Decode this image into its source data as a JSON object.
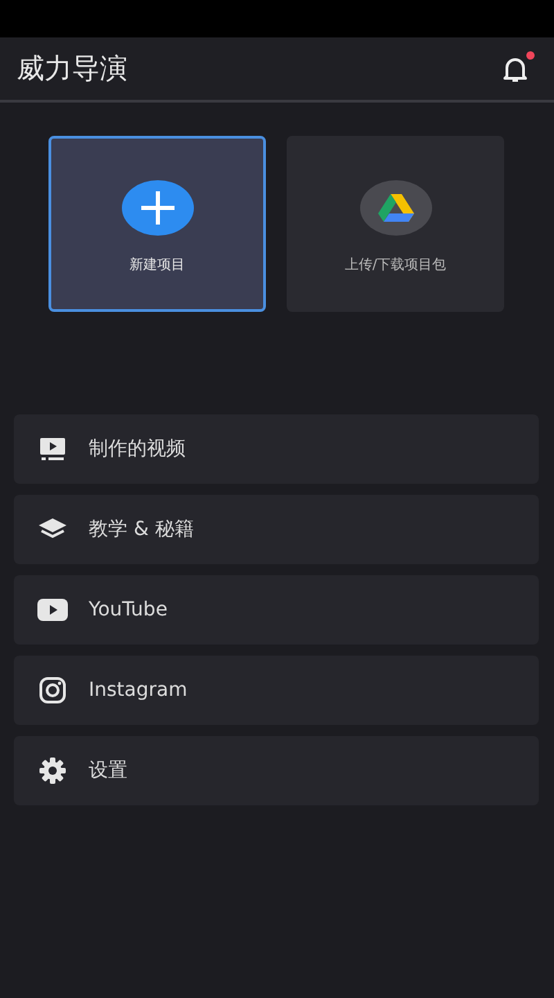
{
  "header": {
    "title": "威力导演",
    "notification_badge": true
  },
  "projects": [
    {
      "label": "新建项目",
      "selected": true
    },
    {
      "label": "上传/下载项目包",
      "selected": false
    }
  ],
  "menu": [
    {
      "label": "制作的视频"
    },
    {
      "label": "教学 & 秘籍"
    },
    {
      "label": "YouTube"
    },
    {
      "label": "Instagram"
    },
    {
      "label": "设置"
    }
  ]
}
